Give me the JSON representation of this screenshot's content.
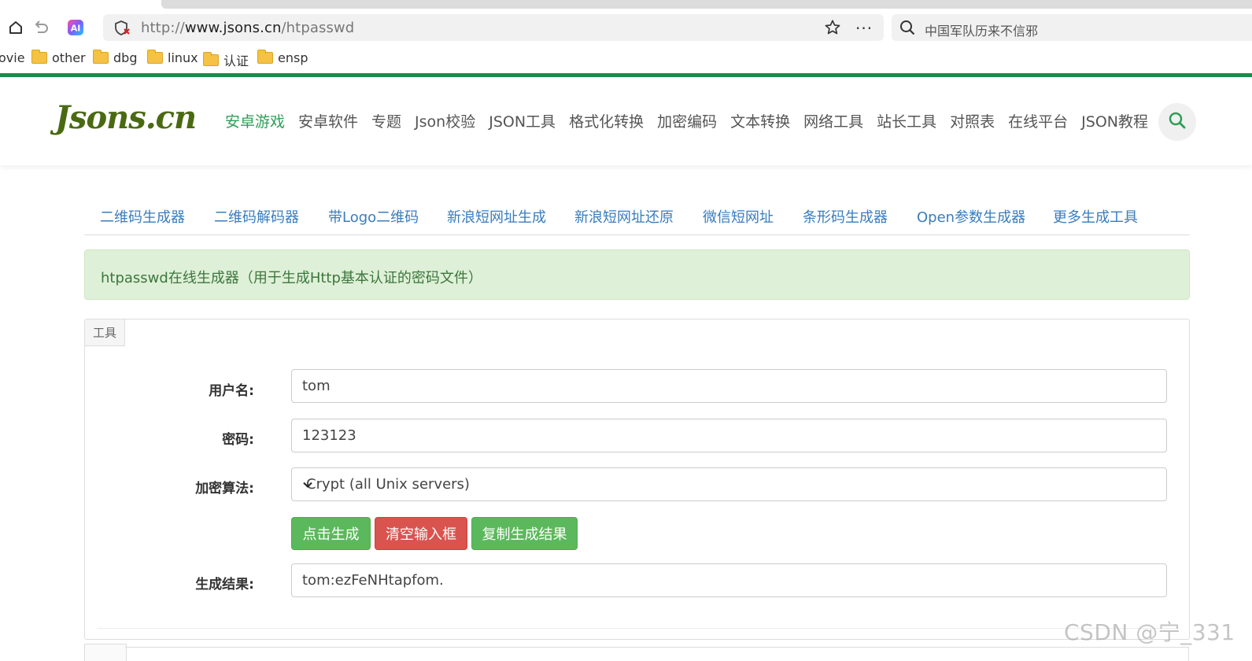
{
  "browser": {
    "url_prefix": "http://",
    "url_domain": "www.jsons.cn",
    "url_path": "/htpasswd",
    "search_query": "中国军队历来不信邪",
    "more_label": "···"
  },
  "bookmarks": [
    {
      "label": "ovie"
    },
    {
      "label": "other"
    },
    {
      "label": "dbg"
    },
    {
      "label": "linux"
    },
    {
      "label": "认证"
    },
    {
      "label": "ensp"
    }
  ],
  "site": {
    "logo": "Jsons.cn",
    "nav": [
      "安卓游戏",
      "安卓软件",
      "专题",
      "Json校验",
      "JSON工具",
      "格式化转换",
      "加密编码",
      "文本转换",
      "网络工具",
      "站长工具",
      "对照表",
      "在线平台",
      "JSON教程"
    ],
    "active_nav": "安卓游戏"
  },
  "subnav": [
    "二维码生成器",
    "二维码解码器",
    "带Logo二维码",
    "新浪短网址生成",
    "新浪短网址还原",
    "微信短网址",
    "条形码生成器",
    "Open参数生成器",
    "更多生成工具"
  ],
  "alert": "htpasswd在线生成器（用于生成Http基本认证的密码文件）",
  "panel": {
    "tab_label": "工具",
    "username_label": "用户名:",
    "username_value": "tom",
    "password_label": "密码:",
    "password_value": "123123",
    "algorithm_label": "加密算法:",
    "algorithm_value": "Crypt (all Unix servers)",
    "generate_button": "点击生成",
    "clear_button": "清空输入框",
    "copy_button": "复制生成结果",
    "result_label": "生成结果:",
    "result_value": "tom:ezFeNHtapfom."
  },
  "watermark": "CSDN @宁_331",
  "colors": {
    "brand_green": "#2e9e57",
    "top_line": "#1e8a4c",
    "link_blue": "#3a7cbd",
    "button_green": "#5cb85c",
    "button_red": "#d9534f",
    "alert_bg": "#dff0d8"
  }
}
